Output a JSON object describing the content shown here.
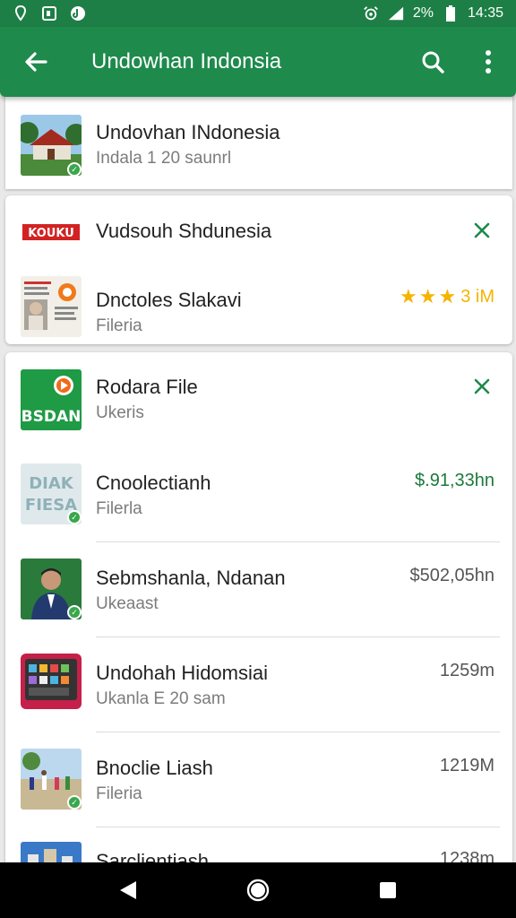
{
  "status": {
    "battery": "2%",
    "time": "14:35"
  },
  "appbar": {
    "title": "Undowhan Indonsia"
  },
  "items": [
    {
      "title": "Undovhan INdonesia",
      "subtitle": "Indala 1 20 saunrl",
      "right": ""
    },
    {
      "title": "Vudsouh Shdunesia",
      "subtitle": "",
      "right": ""
    },
    {
      "title": "Dnctoles Slakavi",
      "subtitle": "Fileria",
      "right": "3 iM"
    },
    {
      "title": "Rodara File",
      "subtitle": "Ukeris",
      "right": ""
    },
    {
      "title": "Cnoolectianh",
      "subtitle": "Filerla",
      "right": "$.91,33hn"
    },
    {
      "title": "Sebmshanla, Ndanan",
      "subtitle": "Ukeaast",
      "right": "$502,05hn"
    },
    {
      "title": "Undohah Hidomsiai",
      "subtitle": "Ukanla E 20 sam",
      "right": "1259m"
    },
    {
      "title": "Bnoclie Liash",
      "subtitle": "Fileria",
      "right": "1219M"
    },
    {
      "title": "Sarclientiash",
      "subtitle": "",
      "right": "1238m"
    }
  ],
  "thumb_labels": {
    "logo_red": "KOUKU",
    "rodara_logo": "BSDAN",
    "faded_logo_top": "DIAK",
    "faded_logo_bottom": "FIESA"
  },
  "colors": {
    "green": "#1e8a4c",
    "price_green": "#1b7a3a",
    "star": "#f4b400"
  },
  "icons": [
    "back-arrow-icon",
    "search-icon",
    "more-vert-icon",
    "close-icon",
    "star-icon",
    "check-icon",
    "nav-back-icon",
    "nav-home-icon",
    "nav-recents-icon"
  ]
}
